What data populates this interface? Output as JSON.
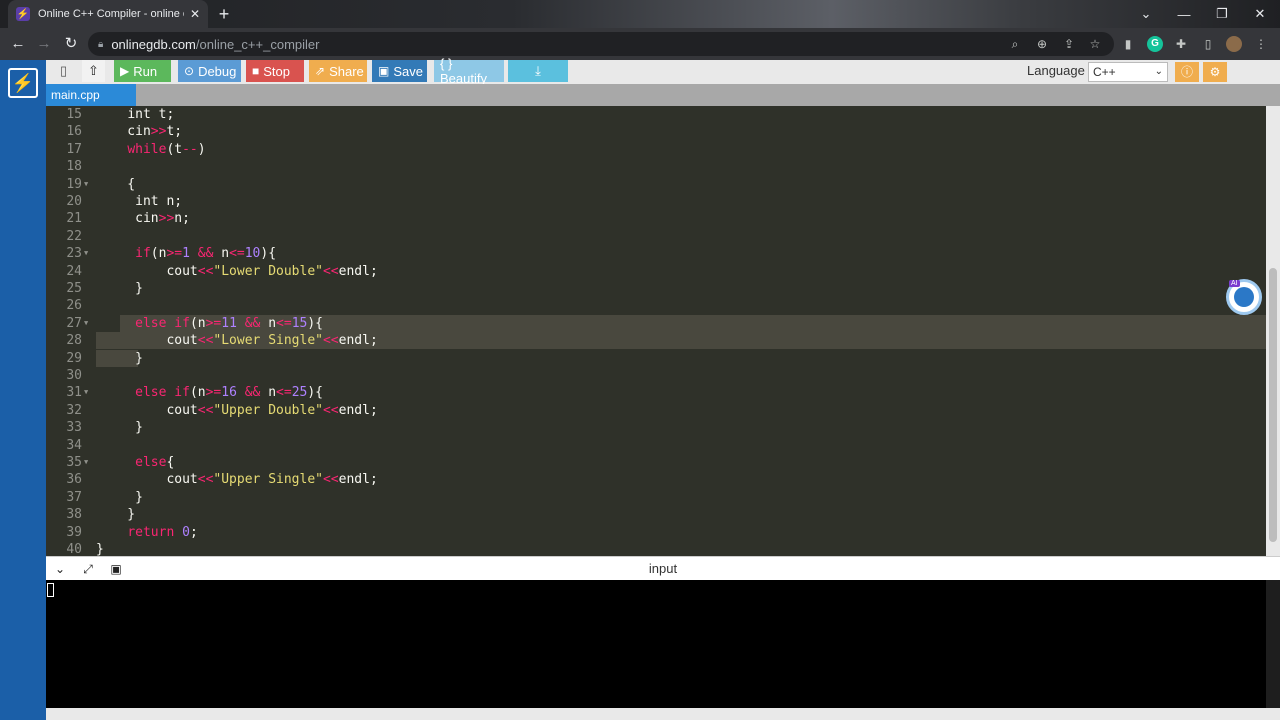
{
  "browser": {
    "tab_title": "Online C++ Compiler - online ed",
    "url_host": "onlinegdb.com",
    "url_path": "/online_c++_compiler"
  },
  "toolbar": {
    "run": "Run",
    "debug": "Debug",
    "stop": "Stop",
    "share": "Share",
    "save": "Save",
    "beautify": "{ } Beautify",
    "language_label": "Language",
    "language_value": "C++"
  },
  "file_tab": "main.cpp",
  "editor": {
    "lines": [
      {
        "n": "15",
        "fold": ""
      },
      {
        "n": "16",
        "fold": ""
      },
      {
        "n": "17",
        "fold": ""
      },
      {
        "n": "18",
        "fold": ""
      },
      {
        "n": "19",
        "fold": "▼"
      },
      {
        "n": "20",
        "fold": ""
      },
      {
        "n": "21",
        "fold": ""
      },
      {
        "n": "22",
        "fold": ""
      },
      {
        "n": "23",
        "fold": "▼"
      },
      {
        "n": "24",
        "fold": ""
      },
      {
        "n": "25",
        "fold": ""
      },
      {
        "n": "26",
        "fold": ""
      },
      {
        "n": "27",
        "fold": "▼"
      },
      {
        "n": "28",
        "fold": ""
      },
      {
        "n": "29",
        "fold": ""
      },
      {
        "n": "30",
        "fold": ""
      },
      {
        "n": "31",
        "fold": "▼"
      },
      {
        "n": "32",
        "fold": ""
      },
      {
        "n": "33",
        "fold": ""
      },
      {
        "n": "34",
        "fold": ""
      },
      {
        "n": "35",
        "fold": "▼"
      },
      {
        "n": "36",
        "fold": ""
      },
      {
        "n": "37",
        "fold": ""
      },
      {
        "n": "38",
        "fold": ""
      },
      {
        "n": "39",
        "fold": ""
      },
      {
        "n": "40",
        "fold": ""
      }
    ],
    "code": [
      "    int t;",
      "    cin>>t;",
      "    while(t--)",
      "",
      "    {",
      "     int n;",
      "     cin>>n;",
      "",
      "     if(n>=1 && n<=10){",
      "         cout<<\"Lower Double\"<<endl;",
      "     }",
      "",
      "     else if(n>=11 && n<=15){",
      "         cout<<\"Lower Single\"<<endl;",
      "     }",
      "",
      "     else if(n>=16 && n<=25){",
      "         cout<<\"Upper Double\"<<endl;",
      "     }",
      "",
      "     else{",
      "         cout<<\"Upper Single\"<<endl;",
      "     }",
      "    }",
      "    return 0;",
      "}"
    ]
  },
  "input_panel": {
    "title": "input"
  },
  "colors": {
    "rail": "#1b5fa8",
    "run": "#5cb85c",
    "debug": "#5b9bd5",
    "stop": "#d9534f",
    "share": "#f0ad4e",
    "save": "#337ab7",
    "beautify": "#8ec8e6",
    "download": "#5bc0de"
  }
}
